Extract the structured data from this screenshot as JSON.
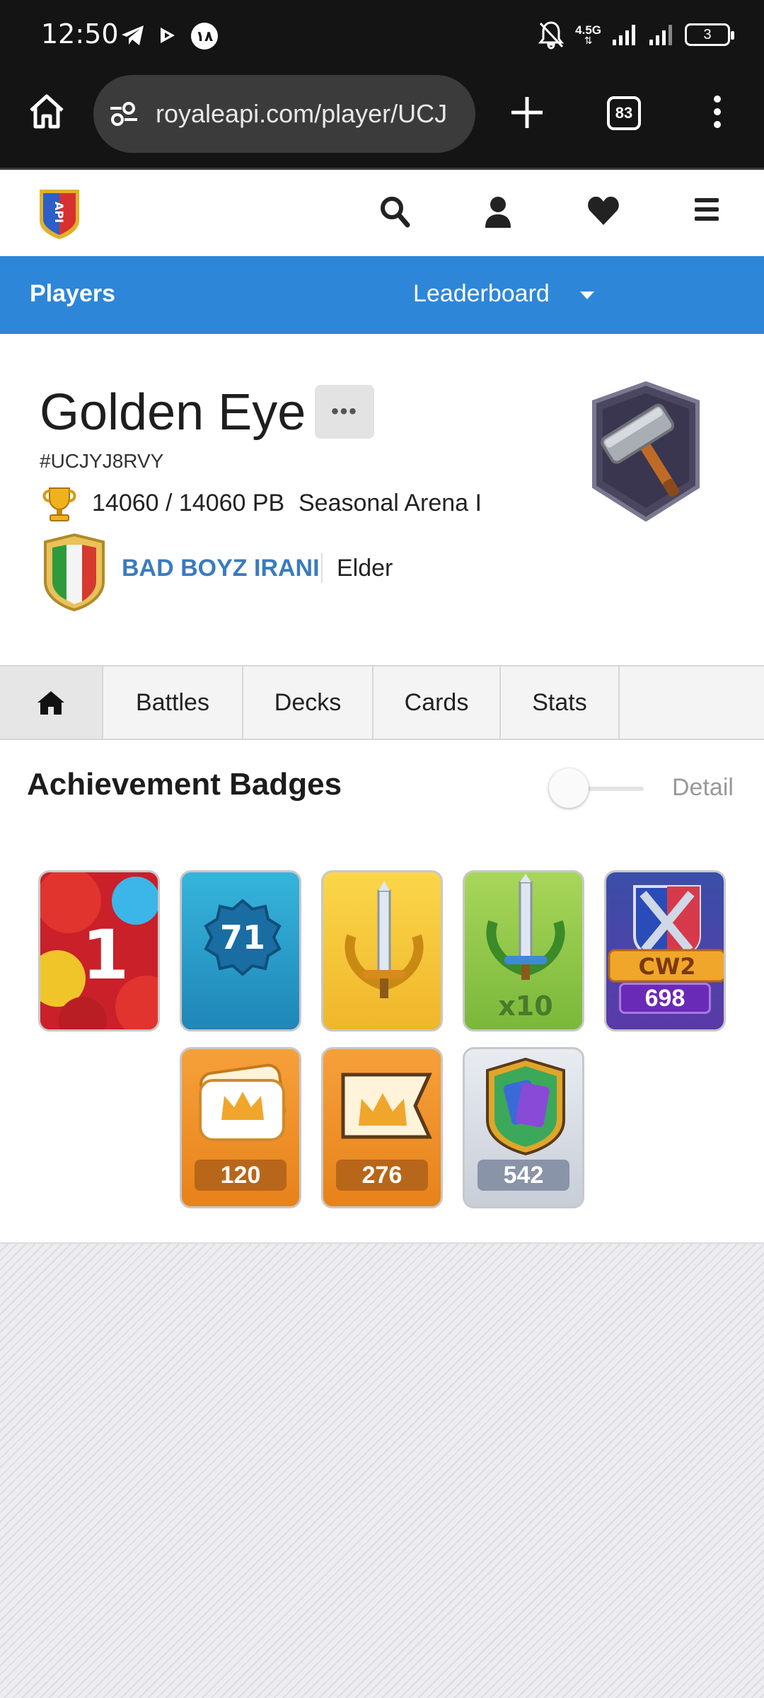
{
  "status_bar": {
    "time": "12:50",
    "network": "4.5G",
    "battery": "3"
  },
  "browser": {
    "url": "royaleapi.com/player/UCJ",
    "tab_count": "83"
  },
  "site": {
    "logo_text": "API"
  },
  "nav": {
    "players": "Players",
    "leaderboard": "Leaderboard"
  },
  "player": {
    "name": "Golden Eye",
    "more": "•••",
    "tag": "#UCJYJ8RVY",
    "trophies": "14060 / 14060 PB",
    "arena": "Seasonal Arena I",
    "clan_name": "BAD BOYZ IRANI",
    "clan_role": "Elder"
  },
  "tabs": {
    "battles": "Battles",
    "decks": "Decks",
    "cards": "Cards",
    "stats": "Stats"
  },
  "achievements": {
    "title": "Achievement Badges",
    "detail_label": "Detail",
    "detail_on": false,
    "badges": [
      {
        "name": "ranked-1-badge",
        "text": "1"
      },
      {
        "name": "level-badge",
        "text": "71"
      },
      {
        "name": "gold-sword-badge",
        "text": ""
      },
      {
        "name": "green-sword-badge",
        "text": "x10"
      },
      {
        "name": "clan-wars-badge",
        "label": "CW2",
        "text": "698"
      },
      {
        "name": "crown-card-badge",
        "text": "120"
      },
      {
        "name": "crown-flag-badge",
        "text": "276"
      },
      {
        "name": "card-collection-badge",
        "text": "542"
      }
    ]
  },
  "colors": {
    "nav_blue": "#2e86d8",
    "clan_link": "#3a7bc0",
    "status_bg": "#141414"
  }
}
